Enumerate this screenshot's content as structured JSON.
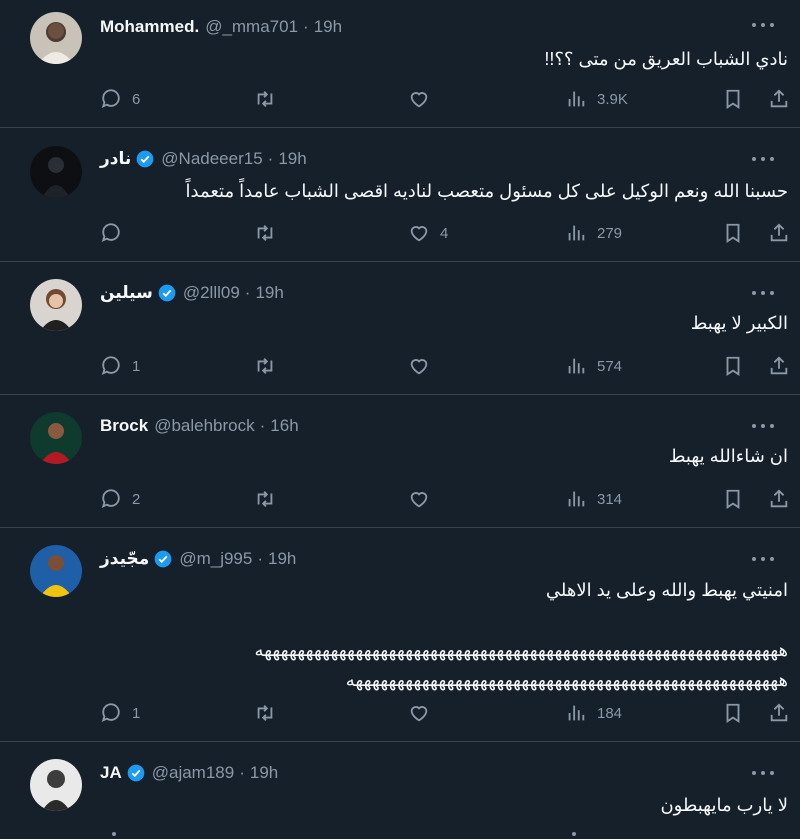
{
  "colors": {
    "background": "#15202b",
    "text": "#f7f9f9",
    "muted": "#8b98a5",
    "verified": "#1d9bf0",
    "divider": "#38444d"
  },
  "icons": {
    "reply": "reply-icon",
    "retweet": "retweet-icon",
    "like": "heart-icon",
    "views": "views-icon",
    "bookmark": "bookmark-icon",
    "share": "share-icon",
    "more": "more-icon",
    "verified": "verified-badge-icon"
  },
  "tweets": [
    {
      "name": "Mohammed.",
      "handle": "@_mma701",
      "separator": "·",
      "time": "19h",
      "verified": false,
      "text": "نادي الشباب العريق من متى ؟؟!!",
      "replies": "6",
      "retweets": "",
      "likes": "",
      "views": "3.9K"
    },
    {
      "name": "نادر",
      "handle": "@Nadeeer15",
      "separator": "·",
      "time": "19h",
      "verified": true,
      "text": "حسبنا الله ونعم الوكيل على كل مسئول متعصب لناديه اقصى الشباب عامداً متعمداً",
      "replies": "",
      "retweets": "",
      "likes": "4",
      "views": "279"
    },
    {
      "name": "سيلين",
      "handle": "@2lll09",
      "separator": "·",
      "time": "19h",
      "verified": true,
      "text": "الكبير لا يهبط",
      "replies": "1",
      "retweets": "",
      "likes": "",
      "views": "574"
    },
    {
      "name": "Brock",
      "handle": "@balehbrock",
      "separator": "·",
      "time": "16h",
      "verified": false,
      "text": "ان شاءالله يهبط",
      "replies": "2",
      "retweets": "",
      "likes": "",
      "views": "314"
    },
    {
      "name": "مجّيدز",
      "handle": "@m_j995",
      "separator": "·",
      "time": "19h",
      "verified": true,
      "text": "امنيتي يهبط والله وعلى يد الاهلي\n\nهههههههههههههههههههههههههههههههههههههههههههههههههههههههههههههههه\nههههههههههههههههههههههههههههههههههههههههههههههههههههه",
      "replies": "1",
      "retweets": "",
      "likes": "",
      "views": "184"
    },
    {
      "name": "JA",
      "handle": "@ajam189",
      "separator": "·",
      "time": "19h",
      "verified": true,
      "text": "لا يارب مايهبطون",
      "replies": "",
      "retweets": "",
      "likes": "",
      "views": ""
    }
  ]
}
